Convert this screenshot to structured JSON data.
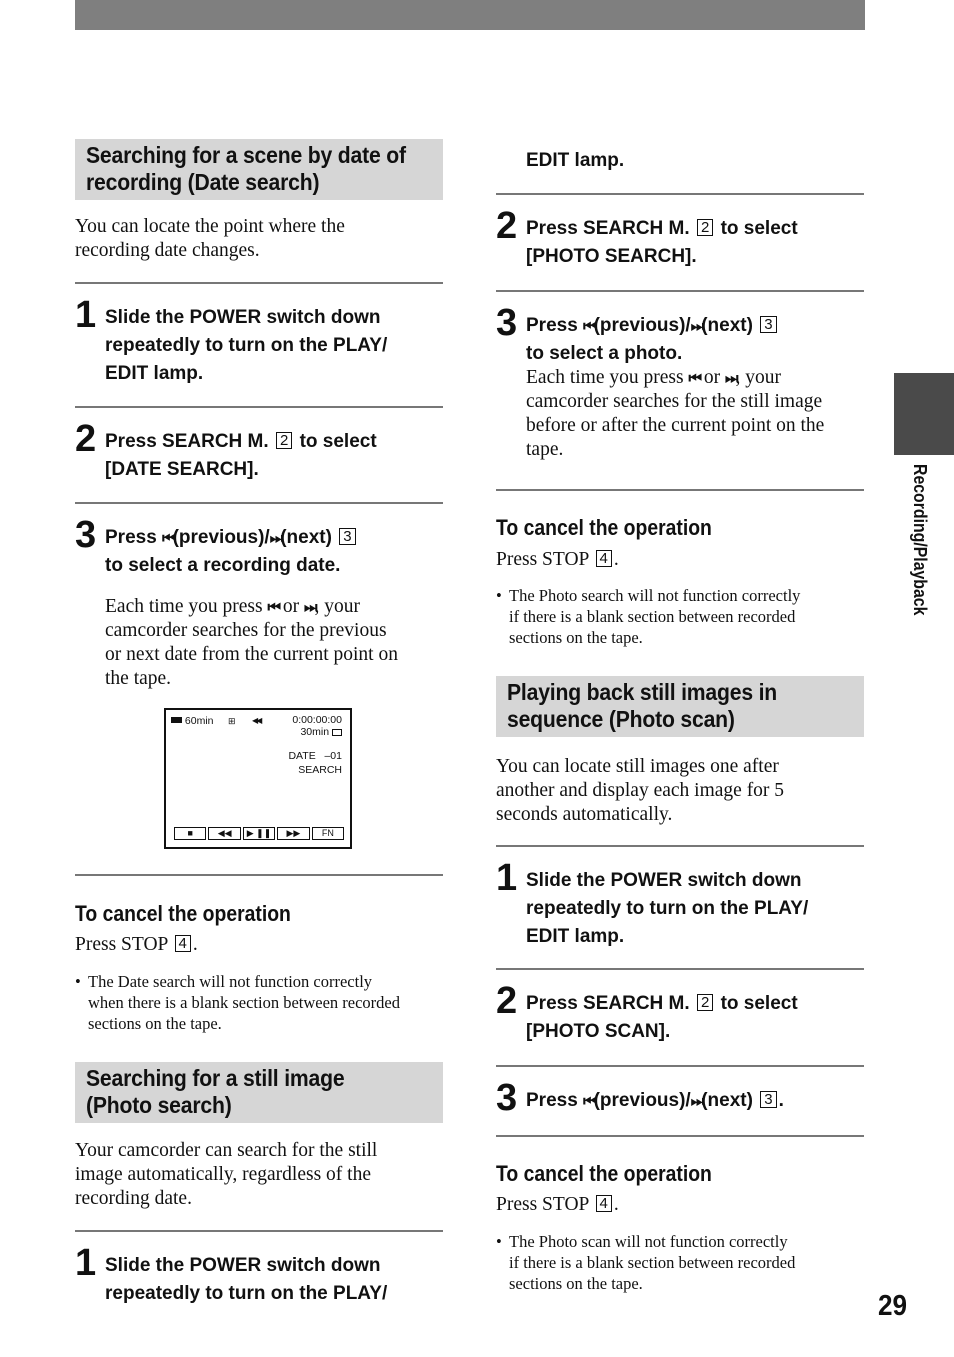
{
  "page": {
    "number": "29",
    "side_tab_label": "Recording/Playback",
    "colors": {
      "top_bar": "#7f7f7f",
      "section_header_bg": "#d6d6d6",
      "side_tab": "#4a4a4a",
      "rule": "#777777"
    }
  },
  "icons": {
    "prev": "⏮",
    "next": "⏭"
  },
  "date_search": {
    "title_lines": [
      "Searching for a scene by date of",
      "recording (Date search)"
    ],
    "intro_lines": [
      "You can locate the point where the",
      "recording date changes."
    ],
    "steps": [
      {
        "num": "1",
        "lines": [
          "Slide the POWER switch down",
          "repeatedly to turn on the PLAY/",
          "EDIT lamp."
        ]
      },
      {
        "num": "2",
        "pre": "Press SEARCH M.",
        "key": "2",
        "post": "to select",
        "line2": "[DATE SEARCH]."
      },
      {
        "num": "3",
        "pre": "Press",
        "prev_label": "(previous)/",
        "next_label": "(next)",
        "key": "3",
        "line2": "to select a recording date.",
        "desc_pre": "Each time you press",
        "desc_or": "or",
        "desc_post": ", your",
        "desc_lines": [
          "camcorder searches for the previous",
          "or next date from the current point on",
          "the tape."
        ]
      }
    ],
    "lcd": {
      "battery": "60min",
      "mode_icon": "⊞",
      "rewind_icon": "◀◀",
      "timecode": "0:00:00:00",
      "tape_remaining": "30min",
      "date_label": "DATE",
      "date_value": "–01",
      "search_label": "SEARCH",
      "buttons": [
        "■",
        "◀◀",
        "▶  ❚❚",
        "▶▶",
        "FN"
      ]
    },
    "cancel": {
      "heading": "To cancel the operation",
      "text_pre": "Press STOP",
      "key": "4",
      "note_lines": [
        "The Date search will not function correctly",
        "when there is a blank section between recorded",
        "sections on the tape."
      ]
    }
  },
  "photo_search": {
    "title_lines": [
      "Searching for a still image",
      "(Photo search)"
    ],
    "intro_lines": [
      "Your camcorder can search for the still",
      "image automatically, regardless of the",
      "recording date."
    ],
    "steps": [
      {
        "num": "1",
        "lines": [
          "Slide the POWER switch down",
          "repeatedly to turn on the PLAY/",
          "EDIT lamp."
        ]
      },
      {
        "num": "2",
        "pre": "Press SEARCH M.",
        "key": "2",
        "post": "to select",
        "line2": "[PHOTO SEARCH]."
      },
      {
        "num": "3",
        "pre": "Press",
        "prev_label": "(previous)/",
        "next_label": "(next)",
        "key": "3",
        "line2": "to select a photo.",
        "desc_pre": "Each time you press",
        "desc_or": "or",
        "desc_post": ", your",
        "desc_lines": [
          "camcorder searches for the still image",
          "before or after the current point on the",
          "tape."
        ]
      }
    ],
    "cancel": {
      "heading": "To cancel the operation",
      "text_pre": "Press STOP",
      "key": "4",
      "note_lines": [
        "The Photo search will not function correctly",
        "if there is a blank section between recorded",
        "sections on the tape."
      ]
    }
  },
  "photo_scan": {
    "title_lines": [
      "Playing back still images in",
      "sequence (Photo scan)"
    ],
    "intro_lines": [
      "You can locate still images one after",
      "another and display each image for 5",
      "seconds automatically."
    ],
    "steps": [
      {
        "num": "1",
        "lines": [
          "Slide the POWER switch down",
          "repeatedly to turn on the PLAY/",
          "EDIT lamp."
        ]
      },
      {
        "num": "2",
        "pre": "Press SEARCH M.",
        "key": "2",
        "post": "to select",
        "line2": "[PHOTO SCAN]."
      },
      {
        "num": "3",
        "pre": "Press",
        "prev_label": "(previous)/",
        "next_label": "(next)",
        "key": "3",
        "end": "."
      }
    ],
    "cancel": {
      "heading": "To cancel the operation",
      "text_pre": "Press STOP",
      "key": "4",
      "note_lines": [
        "The Photo scan will not function correctly",
        "if there is a blank section between recorded",
        "sections on the tape."
      ]
    }
  }
}
